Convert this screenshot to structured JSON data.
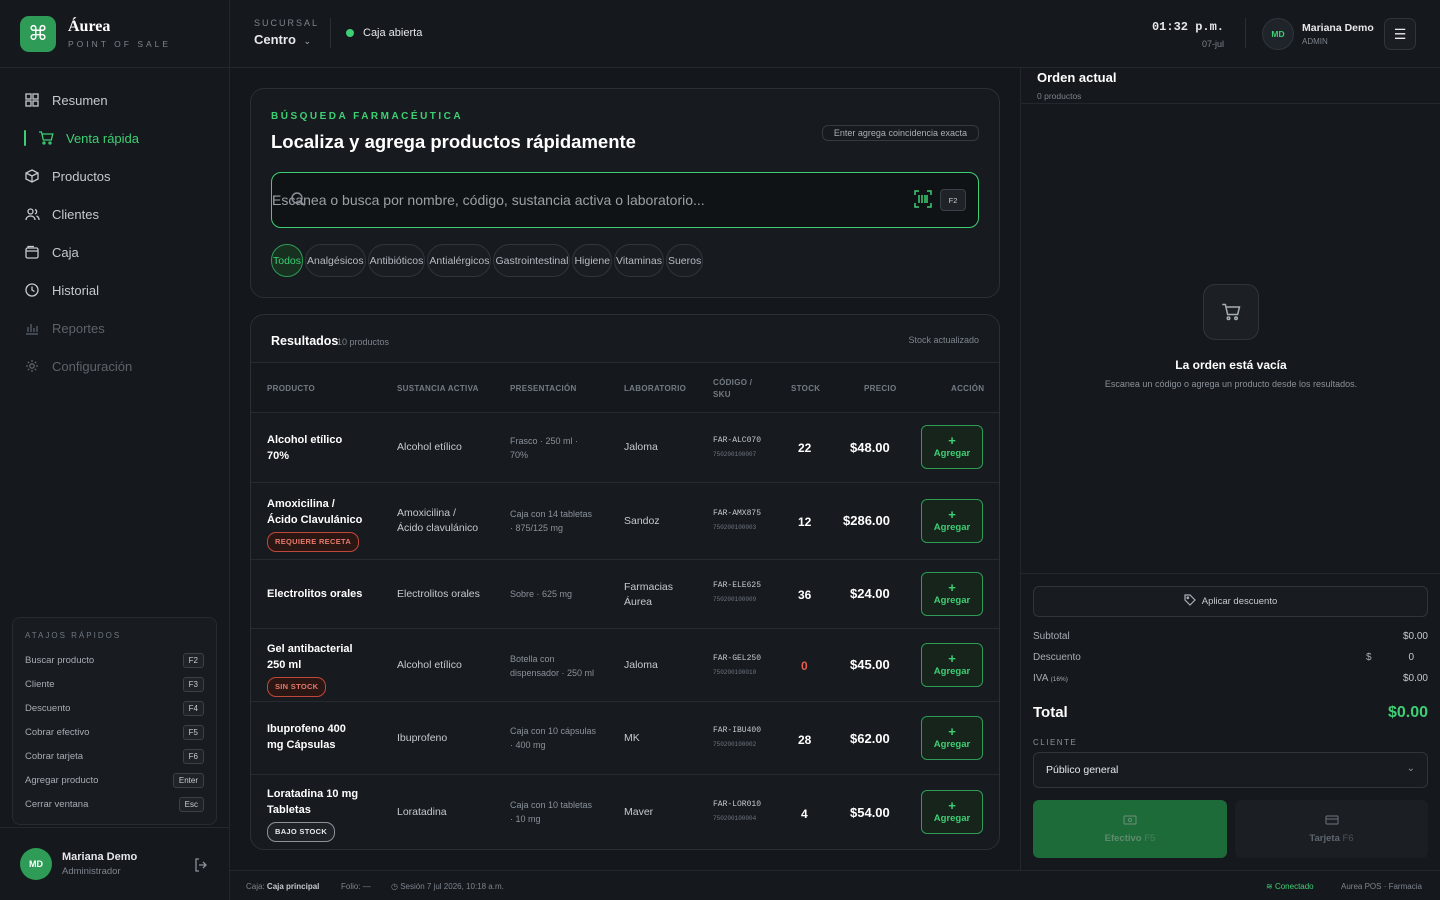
{
  "brand": {
    "title": "Áurea",
    "subtitle": "POINT OF SALE",
    "accent": "#3ecf74"
  },
  "nav": {
    "items": [
      {
        "label": "Resumen",
        "icon": "grid-icon"
      },
      {
        "label": "Venta rápida",
        "icon": "cart-icon",
        "active": true
      },
      {
        "label": "Productos",
        "icon": "box-icon"
      },
      {
        "label": "Clientes",
        "icon": "users-icon"
      },
      {
        "label": "Caja",
        "icon": "register-icon"
      },
      {
        "label": "Historial",
        "icon": "history-icon"
      },
      {
        "label": "Reportes",
        "icon": "chart-icon",
        "disabled": true
      },
      {
        "label": "Configuración",
        "icon": "gear-icon",
        "disabled": true
      }
    ]
  },
  "shortcuts": {
    "title": "ATAJOS RÁPIDOS",
    "items": [
      {
        "label": "Buscar producto",
        "key": "F2"
      },
      {
        "label": "Cliente",
        "key": "F3"
      },
      {
        "label": "Descuento",
        "key": "F4"
      },
      {
        "label": "Cobrar efectivo",
        "key": "F5"
      },
      {
        "label": "Cobrar tarjeta",
        "key": "F6"
      },
      {
        "label": "Agregar producto",
        "key": "Enter"
      },
      {
        "label": "Cerrar ventana",
        "key": "Esc"
      }
    ]
  },
  "user": {
    "initials": "MD",
    "name": "Mariana Demo",
    "role": "Administrador",
    "role_short": "ADMIN"
  },
  "topbar": {
    "branch_label": "SUCURSAL",
    "branch_value": "Centro",
    "register_status": "Caja abierta",
    "time": "01:32 p.m.",
    "date": "07-jul"
  },
  "search": {
    "eyebrow": "BÚSQUEDA FARMACÉUTICA",
    "heading": "Localiza y agrega productos rápidamente",
    "hint": "Enter agrega coincidencia exacta",
    "placeholder": "Escanea o busca por nombre, código, sustancia activa o laboratorio...",
    "value": "",
    "key": "F2",
    "categories": [
      "Todos",
      "Analgésicos",
      "Antibióticos",
      "Antialérgicos",
      "Gastrointestinal",
      "Higiene",
      "Vitaminas",
      "Sueros"
    ]
  },
  "results": {
    "title": "Resultados",
    "count": "10 productos",
    "stock_note": "Stock actualizado",
    "columns": [
      "PRODUCTO",
      "SUSTANCIA ACTIVA",
      "PRESENTACIÓN",
      "LABORATORIO",
      "CÓDIGO /",
      "SKU",
      "STOCK",
      "PRECIO",
      "ACCIÓN"
    ],
    "add_label": "Agregar",
    "rows": [
      {
        "name1": "Alcohol etílico",
        "name2": "70%",
        "badge": "",
        "substance1": "Alcohol etílico",
        "substance2": "",
        "presentation1": "Frasco · 250 ml ·",
        "presentation2": "70%",
        "lab1": "Jaloma",
        "lab2": "",
        "sku": "FAR-ALC070",
        "barcode": "750200100007",
        "stock": "22",
        "price": "$48.00"
      },
      {
        "name1": "Amoxicilina /",
        "name2": "Ácido Clavulánico",
        "badge": "REQUIERE RECETA",
        "substance1": "Amoxicilina /",
        "substance2": "Ácido clavulánico",
        "presentation1": "Caja con 14 tabletas",
        "presentation2": "· 875/125 mg",
        "lab1": "Sandoz",
        "lab2": "",
        "sku": "FAR-AMX875",
        "barcode": "750200100003",
        "stock": "12",
        "price": "$286.00"
      },
      {
        "name1": "Electrolitos orales",
        "name2": "",
        "badge": "",
        "substance1": "Electrolitos orales",
        "substance2": "",
        "presentation1": "Sobre · 625 mg",
        "presentation2": "",
        "lab1": "Farmacias",
        "lab2": "Áurea",
        "sku": "FAR-ELE625",
        "barcode": "750200100009",
        "stock": "36",
        "price": "$24.00"
      },
      {
        "name1": "Gel antibacterial",
        "name2": "250 ml",
        "badge": "SIN STOCK",
        "substance1": "Alcohol etílico",
        "substance2": "",
        "presentation1": "Botella con",
        "presentation2": "dispensador · 250 ml",
        "lab1": "Jaloma",
        "lab2": "",
        "sku": "FAR-GEL250",
        "barcode": "750200100010",
        "stock": "0",
        "price": "$45.00"
      },
      {
        "name1": "Ibuprofeno 400",
        "name2": "mg Cápsulas",
        "badge": "",
        "substance1": "Ibuprofeno",
        "substance2": "",
        "presentation1": "Caja con 10 cápsulas",
        "presentation2": "· 400 mg",
        "lab1": "MK",
        "lab2": "",
        "sku": "FAR-IBU400",
        "barcode": "750200100002",
        "stock": "28",
        "price": "$62.00"
      },
      {
        "name1": "Loratadina 10 mg",
        "name2": "Tabletas",
        "badge": "BAJO STOCK",
        "substance1": "Loratadina",
        "substance2": "",
        "presentation1": "Caja con 10 tabletas",
        "presentation2": "· 10 mg",
        "lab1": "Maver",
        "lab2": "",
        "sku": "FAR-LOR010",
        "barcode": "750200100004",
        "stock": "4",
        "price": "$54.00"
      }
    ]
  },
  "order": {
    "title": "Orden actual",
    "count": "0 productos",
    "empty_title": "La orden está vacía",
    "empty_sub": "Escanea un código o agrega un producto desde los resultados.",
    "discount_button": "Aplicar descuento",
    "subtotal_label": "Subtotal",
    "subtotal": "$0.00",
    "discount_label": "Descuento",
    "discount_currency": "$",
    "discount_value": "0",
    "tax_label": "IVA",
    "tax_rate": "(16%)",
    "tax": "$0.00",
    "total_label": "Total",
    "total": "$0.00",
    "client_label": "CLIENTE",
    "client_value": "Público general",
    "cash_label": "Efectivo",
    "cash_key": "F5",
    "card_label": "Tarjeta",
    "card_key": "F6"
  },
  "statusbar": {
    "caja_label": "Caja:",
    "caja_value": "Caja principal",
    "folio": "Folio: —",
    "session": "Sesión 7 jul 2026, 10:18 a.m.",
    "connection": "Conectado",
    "product": "Aurea POS · Farmacia"
  }
}
